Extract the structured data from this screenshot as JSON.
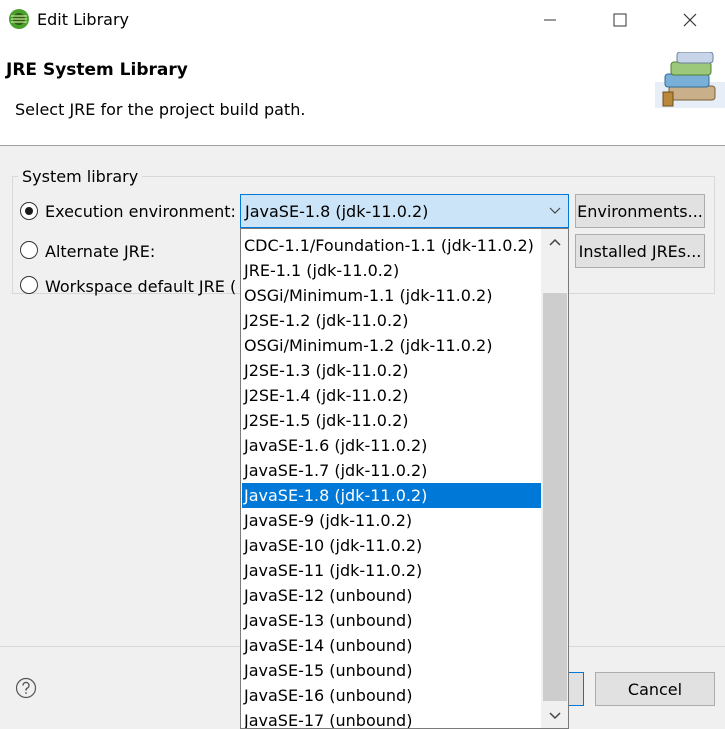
{
  "window": {
    "title": "Edit Library",
    "icons": {
      "app": "eclipse-icon",
      "minimize": "minimize-icon",
      "maximize": "maximize-icon",
      "close": "close-icon"
    }
  },
  "header": {
    "title": "JRE System Library",
    "description": "Select JRE for the project build path.",
    "art_icon": "library-books-icon"
  },
  "group": {
    "label": "System library",
    "options": {
      "execution_environment": {
        "label": "Execution environment:",
        "checked": true
      },
      "alternate_jre": {
        "label": "Alternate JRE:",
        "checked": false
      },
      "workspace_default": {
        "label": "Workspace default JRE (",
        "checked": false
      }
    },
    "combo_value": "JavaSE-1.8 (jdk-11.0.2)",
    "environments_button": "Environments...",
    "installed_jres_button": "Installed JREs..."
  },
  "dropdown": {
    "selected_index": 10,
    "items": [
      "CDC-1.1/Foundation-1.1 (jdk-11.0.2)",
      "JRE-1.1 (jdk-11.0.2)",
      "OSGi/Minimum-1.1 (jdk-11.0.2)",
      "J2SE-1.2 (jdk-11.0.2)",
      "OSGi/Minimum-1.2 (jdk-11.0.2)",
      "J2SE-1.3 (jdk-11.0.2)",
      "J2SE-1.4 (jdk-11.0.2)",
      "J2SE-1.5 (jdk-11.0.2)",
      "JavaSE-1.6 (jdk-11.0.2)",
      "JavaSE-1.7 (jdk-11.0.2)",
      "JavaSE-1.8 (jdk-11.0.2)",
      "JavaSE-9 (jdk-11.0.2)",
      "JavaSE-10 (jdk-11.0.2)",
      "JavaSE-11 (jdk-11.0.2)",
      "JavaSE-12 (unbound)",
      "JavaSE-13 (unbound)",
      "JavaSE-14 (unbound)",
      "JavaSE-15 (unbound)",
      "JavaSE-16 (unbound)",
      "JavaSE-17 (unbound)"
    ]
  },
  "footer": {
    "cancel_button": "Cancel",
    "help_icon": "help-icon"
  },
  "colors": {
    "accent": "#0078d7",
    "selection_text": "#ffffff",
    "combo_background": "#cce4f7",
    "dialog_background": "#f0f0f0"
  }
}
